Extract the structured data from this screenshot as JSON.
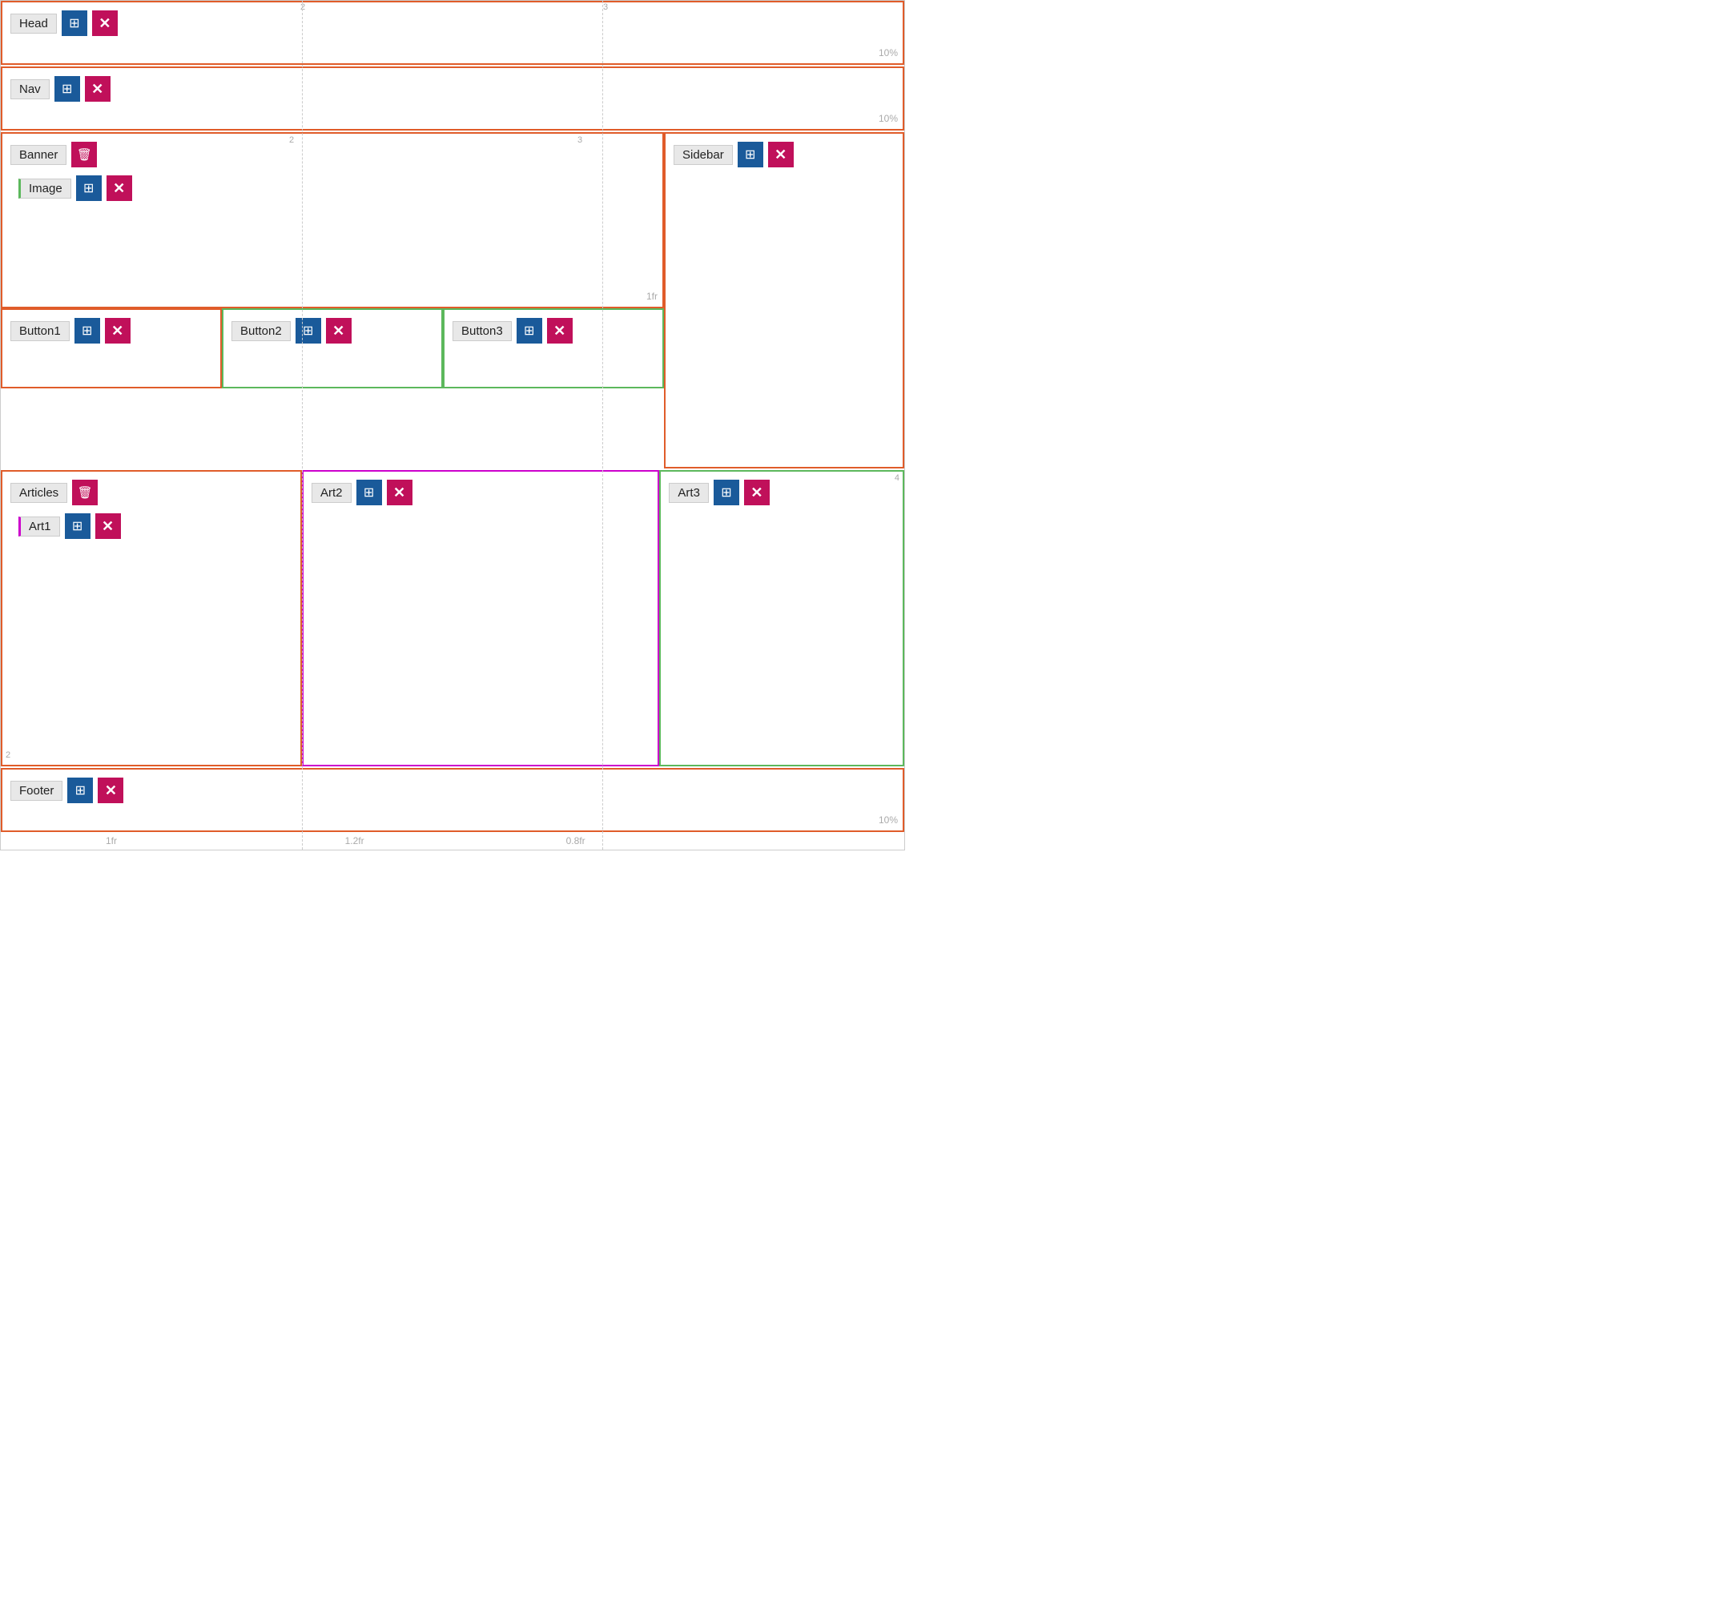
{
  "grid": {
    "numbers": [
      "2",
      "3"
    ],
    "vline1_pct": 33.3,
    "vline2_pct": 66.6,
    "fractions": {
      "col1": "1fr",
      "col2": "1.2fr",
      "col3": "0.8fr"
    },
    "row_pcts": {
      "head": "10%",
      "nav": "10%",
      "banner": "1fr",
      "footer": "10%"
    }
  },
  "components": {
    "head": {
      "label": "Head"
    },
    "nav": {
      "label": "Nav"
    },
    "banner": {
      "label": "Banner"
    },
    "image": {
      "label": "Image"
    },
    "sidebar": {
      "label": "Sidebar"
    },
    "button1": {
      "label": "Button1"
    },
    "button2": {
      "label": "Button2"
    },
    "button3": {
      "label": "Button3"
    },
    "articles": {
      "label": "Articles"
    },
    "art1": {
      "label": "Art1"
    },
    "art2": {
      "label": "Art2"
    },
    "art3": {
      "label": "Art3"
    },
    "footer": {
      "label": "Footer"
    }
  },
  "icons": {
    "grid": "⊞",
    "close": "✕",
    "trash": "🗑"
  }
}
